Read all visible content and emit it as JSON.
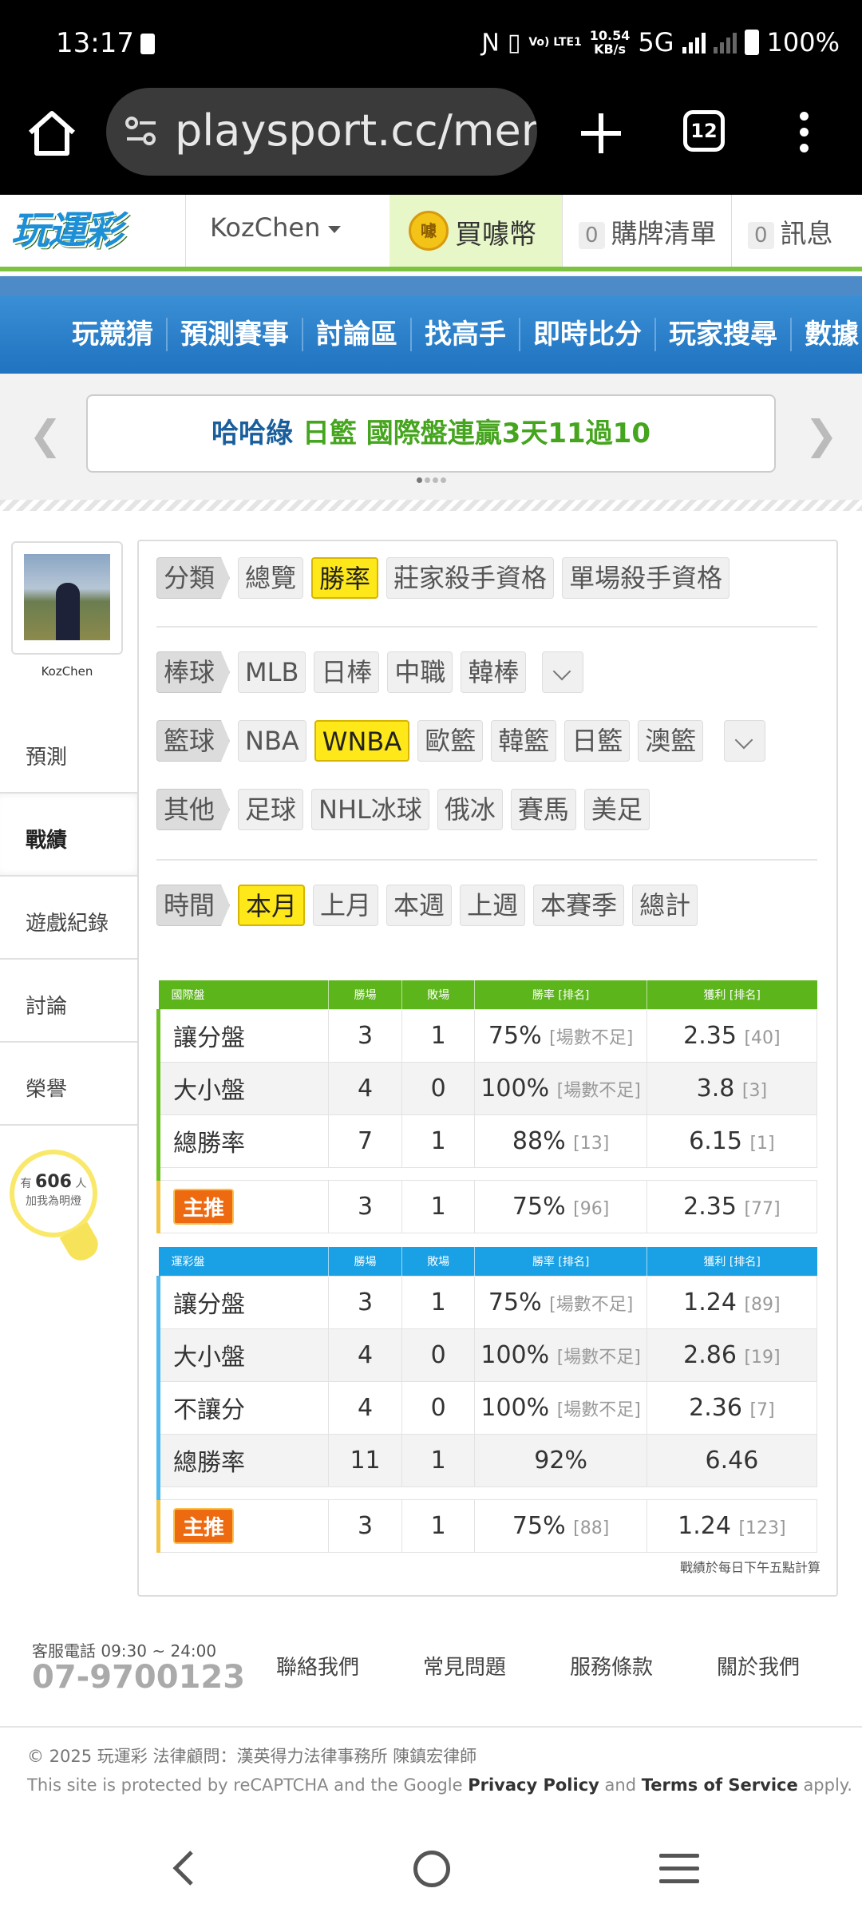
{
  "statusbar": {
    "time": "13:17",
    "volte": "Vo) LTE1",
    "speed_top": "10.54",
    "speed_bottom": "KB/s",
    "network": "5G",
    "battery": "100%"
  },
  "browser": {
    "url": "playsport.cc/mer",
    "tabs_count": "12"
  },
  "header": {
    "logo": "玩運彩",
    "username": "KozChen",
    "buy_coin": "買噱幣",
    "coin_glyph": "噱",
    "cart_count": "0",
    "cart_label": "購牌清單",
    "msg_count": "0",
    "msg_label": "訊息"
  },
  "nav": {
    "items": [
      "玩競猜",
      "預測賽事",
      "討論區",
      "找高手",
      "即時比分",
      "玩家搜尋",
      "數據"
    ]
  },
  "banner": {
    "part1": "哈哈綠",
    "part2": "日籃 國際盤連贏3天11過10"
  },
  "sidebar": {
    "username": "KozChen",
    "menu": [
      "預測",
      "戰績",
      "遊戲紀錄",
      "討論",
      "榮譽"
    ],
    "fans_prefix": "有",
    "fans_count": "606",
    "fans_suffix": "人",
    "fans_caption": "加我為明燈"
  },
  "filters": {
    "category": {
      "head": "分類",
      "options": [
        "總覽",
        "勝率",
        "莊家殺手資格",
        "單場殺手資格"
      ],
      "selected": "勝率"
    },
    "baseball": {
      "head": "棒球",
      "options": [
        "MLB",
        "日棒",
        "中職",
        "韓棒"
      ]
    },
    "basketball": {
      "head": "籃球",
      "options": [
        "NBA",
        "WNBA",
        "歐籃",
        "韓籃",
        "日籃",
        "澳籃"
      ],
      "selected": "WNBA"
    },
    "other": {
      "head": "其他",
      "options": [
        "足球",
        "NHL冰球",
        "俄冰",
        "賽馬",
        "美足"
      ]
    },
    "time": {
      "head": "時間",
      "options": [
        "本月",
        "上月",
        "本週",
        "上週",
        "本賽季",
        "總計"
      ],
      "selected": "本月"
    }
  },
  "intl": {
    "headers": [
      "國際盤",
      "勝場",
      "敗場",
      "勝率 [排名]",
      "獲利 [排名]"
    ],
    "rows": [
      {
        "name": "讓分盤",
        "win": "3",
        "lose": "1",
        "rate": "75%",
        "rate_rank": "[場數不足]",
        "profit": "2.35",
        "profit_rank": "[40]"
      },
      {
        "name": "大小盤",
        "win": "4",
        "lose": "0",
        "rate": "100%",
        "rate_rank": "[場數不足]",
        "profit": "3.8",
        "profit_rank": "[3]"
      },
      {
        "name": "總勝率",
        "win": "7",
        "lose": "1",
        "rate": "88%",
        "rate_rank": "[13]",
        "profit": "6.15",
        "profit_rank": "[1]"
      }
    ],
    "main": {
      "badge": "主推",
      "win": "3",
      "lose": "1",
      "rate": "75%",
      "rate_rank": "[96]",
      "profit": "2.35",
      "profit_rank": "[77]"
    }
  },
  "lottery": {
    "headers": [
      "運彩盤",
      "勝場",
      "敗場",
      "勝率 [排名]",
      "獲利 [排名]"
    ],
    "rows": [
      {
        "name": "讓分盤",
        "win": "3",
        "lose": "1",
        "rate": "75%",
        "rate_rank": "[場數不足]",
        "profit": "1.24",
        "profit_rank": "[89]"
      },
      {
        "name": "大小盤",
        "win": "4",
        "lose": "0",
        "rate": "100%",
        "rate_rank": "[場數不足]",
        "profit": "2.86",
        "profit_rank": "[19]"
      },
      {
        "name": "不讓分",
        "win": "4",
        "lose": "0",
        "rate": "100%",
        "rate_rank": "[場數不足]",
        "profit": "2.36",
        "profit_rank": "[7]"
      },
      {
        "name": "總勝率",
        "win": "11",
        "lose": "1",
        "rate": "92%",
        "rate_rank": "",
        "profit": "6.46",
        "profit_rank": ""
      }
    ],
    "main": {
      "badge": "主推",
      "win": "3",
      "lose": "1",
      "rate": "75%",
      "rate_rank": "[88]",
      "profit": "1.24",
      "profit_rank": "[123]"
    }
  },
  "note": "戰績於每日下午五點計算",
  "footer": {
    "service_hours": "客服電話 09:30 ~ 24:00",
    "phone": "07-9700123",
    "links": [
      "聯絡我們",
      "常見問題",
      "服務條款",
      "關於我們"
    ],
    "copyright": "© 2025 玩運彩 法律顧問：漢英得力法律事務所 陳鎮宏律師",
    "recaptcha_pre": "This site is protected by reCAPTCHA and the Google",
    "privacy": "Privacy Policy",
    "and": "and",
    "terms": "Terms of Service",
    "apply": "apply."
  },
  "colors": {
    "green": "#5cb51a",
    "blue": "#1aa0e4",
    "yellow": "#ffe81a",
    "badge_orange": "#ee6a10",
    "banner_blue": "#1a5f9c",
    "banner_green": "#46a51e"
  }
}
